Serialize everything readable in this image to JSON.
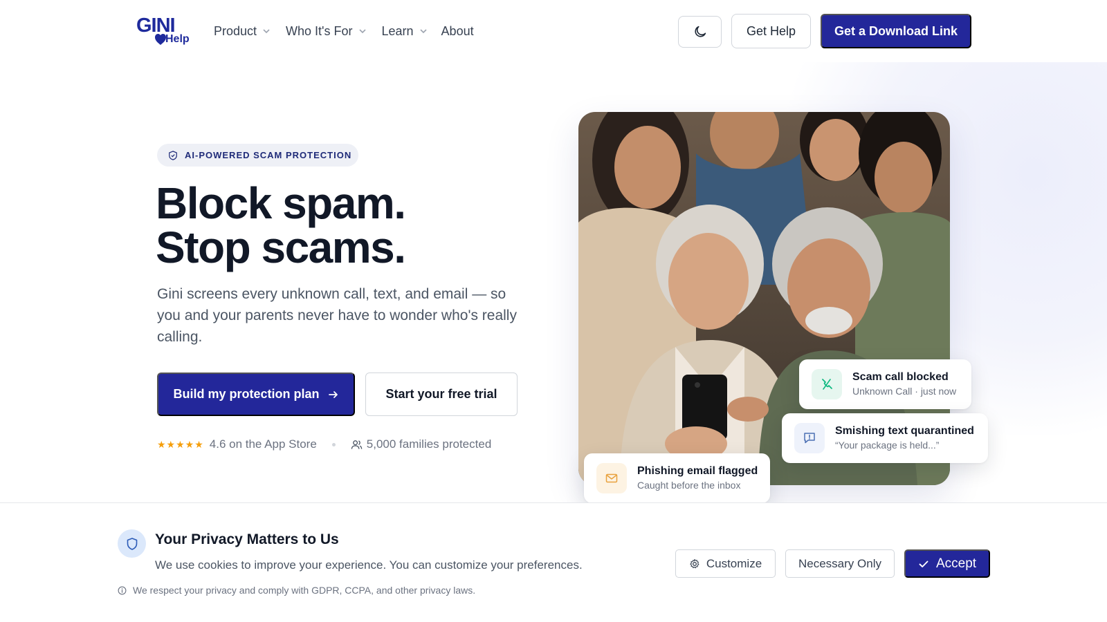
{
  "header": {
    "logo_text": "GINI",
    "logo_sub": "Help",
    "nav": [
      {
        "label": "Product",
        "has_dropdown": true
      },
      {
        "label": "Who It's For",
        "has_dropdown": true
      },
      {
        "label": "Learn",
        "has_dropdown": true
      },
      {
        "label": "About",
        "has_dropdown": false
      }
    ],
    "theme_toggle_icon": "moon-icon",
    "help_label": "Get Help",
    "download_label": "Get a Download Link"
  },
  "hero": {
    "badge": "AI-POWERED SCAM PROTECTION",
    "headline_line1": "Block spam.",
    "headline_line2": "Stop scams.",
    "subtext": "Gini screens every unknown call, text, and email — so you and your parents never have to wonder who's really calling.",
    "cta_primary": "Build my protection plan",
    "cta_secondary": "Start your free trial",
    "stars": "★★★★★",
    "rating_text": "4.6 on the App Store",
    "families_text": "5,000 families protected",
    "photo_icon": "family-photo"
  },
  "cards": {
    "call": {
      "title": "Scam call blocked",
      "subtitle": "Unknown Call · just now",
      "icon": "phone-blocked-icon"
    },
    "sms": {
      "title": "Smishing text quarantined",
      "subtitle": "“Your package is held...”",
      "icon": "message-alert-icon"
    },
    "email": {
      "title": "Phishing email flagged",
      "subtitle": "Caught before the inbox",
      "icon": "mail-icon"
    }
  },
  "cookie_banner": {
    "title": "Your Privacy Matters to Us",
    "description": "We use cookies to improve your experience. You can customize your preferences.",
    "note": "We respect your privacy and comply with GDPR, CCPA, and other privacy laws.",
    "customize_label": "Customize",
    "necessary_label": "Necessary Only",
    "accept_label": "Accept"
  },
  "colors": {
    "brand": "#23279a",
    "text_dark": "#111827",
    "text_muted": "#6b7280",
    "star": "#f59e0b",
    "call_green": "#10b981",
    "sms_blue": "#4a6fb3",
    "email_orange": "#e8a13c"
  }
}
